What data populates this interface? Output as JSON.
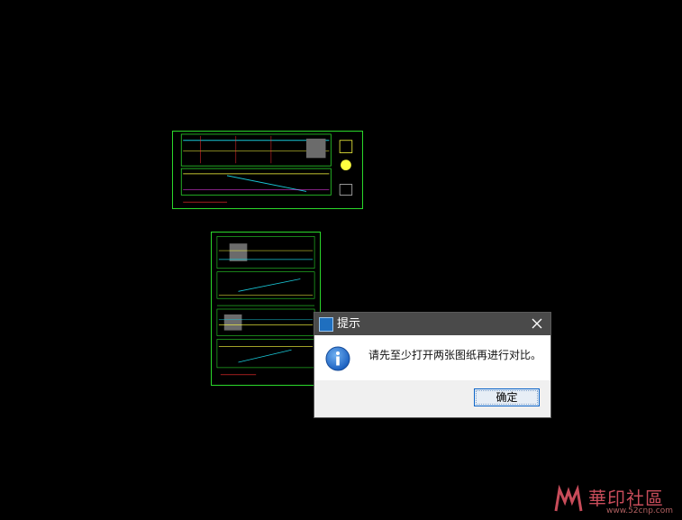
{
  "dialog": {
    "title": "提示",
    "message": "请先至少打开两张图纸再进行对比。",
    "ok_label": "确定",
    "icon": "info-icon"
  },
  "watermark": {
    "text": "華印社區",
    "url": "www.52cnp.com"
  },
  "colors": {
    "background": "#000000",
    "sheet_border": "#2bd82b",
    "titlebar": "#4a4a4a",
    "button_border": "#0a63c7",
    "info_blue": "#1a5fc0"
  }
}
